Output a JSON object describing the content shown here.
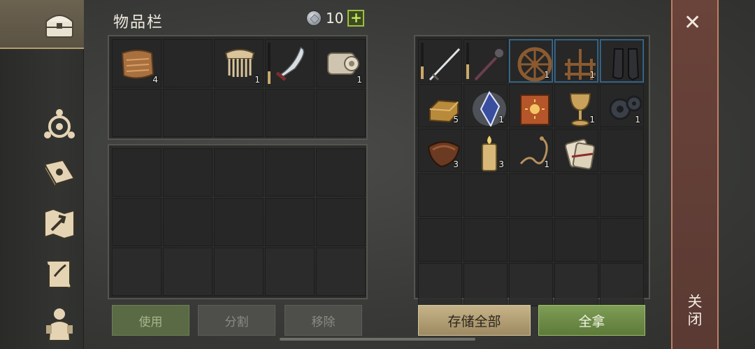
{
  "header": {
    "title": "物品栏",
    "currency_value": "10",
    "add_label": "+"
  },
  "sidebar": {
    "items": [
      {
        "name": "chest-icon"
      },
      {
        "name": "triskelion-icon"
      },
      {
        "name": "spellbook-icon"
      },
      {
        "name": "map-icon"
      },
      {
        "name": "scroll-icon"
      },
      {
        "name": "character-icon"
      }
    ]
  },
  "inventory": {
    "rows": 4,
    "cols": 5,
    "items": [
      {
        "cell": 0,
        "icon": "cloth-icon",
        "count": "4"
      },
      {
        "cell": 2,
        "icon": "comb-icon",
        "count": "1"
      },
      {
        "cell": 3,
        "icon": "saber-icon",
        "count": "",
        "durability": 0.3
      },
      {
        "cell": 4,
        "icon": "fabric-roll-icon",
        "count": "1"
      }
    ]
  },
  "storage": {
    "items": [
      {
        "cell": 0,
        "icon": "sword-icon",
        "count": "",
        "durability": 0.35
      },
      {
        "cell": 1,
        "icon": "mace-icon",
        "count": "",
        "durability": 0.4
      },
      {
        "cell": 2,
        "icon": "wheel-icon",
        "count": "1",
        "selected": true
      },
      {
        "cell": 3,
        "icon": "rack-icon",
        "count": "1",
        "selected": true
      },
      {
        "cell": 4,
        "icon": "boots-icon",
        "count": "",
        "selected": true
      },
      {
        "cell": 5,
        "icon": "ingot-icon",
        "count": "5"
      },
      {
        "cell": 6,
        "icon": "crystal-icon",
        "count": "1"
      },
      {
        "cell": 7,
        "icon": "book-icon",
        "count": ""
      },
      {
        "cell": 8,
        "icon": "chalice-icon",
        "count": "1"
      },
      {
        "cell": 9,
        "icon": "gears-icon",
        "count": "1"
      },
      {
        "cell": 10,
        "icon": "leather-icon",
        "count": "3"
      },
      {
        "cell": 11,
        "icon": "candle-icon",
        "count": "3"
      },
      {
        "cell": 12,
        "icon": "rope-icon",
        "count": "1"
      },
      {
        "cell": 13,
        "icon": "scrolls-icon",
        "count": ""
      }
    ]
  },
  "buttons": {
    "use": "使用",
    "split": "分割",
    "remove": "移除",
    "store_all": "存储全部",
    "take_all": "全拿"
  },
  "close": {
    "icon": "close-icon",
    "label": "关闭"
  },
  "colors": {
    "accent_green": "#9fbf3f",
    "gold": "#c9a96a",
    "close_bg": "#6a433a"
  }
}
